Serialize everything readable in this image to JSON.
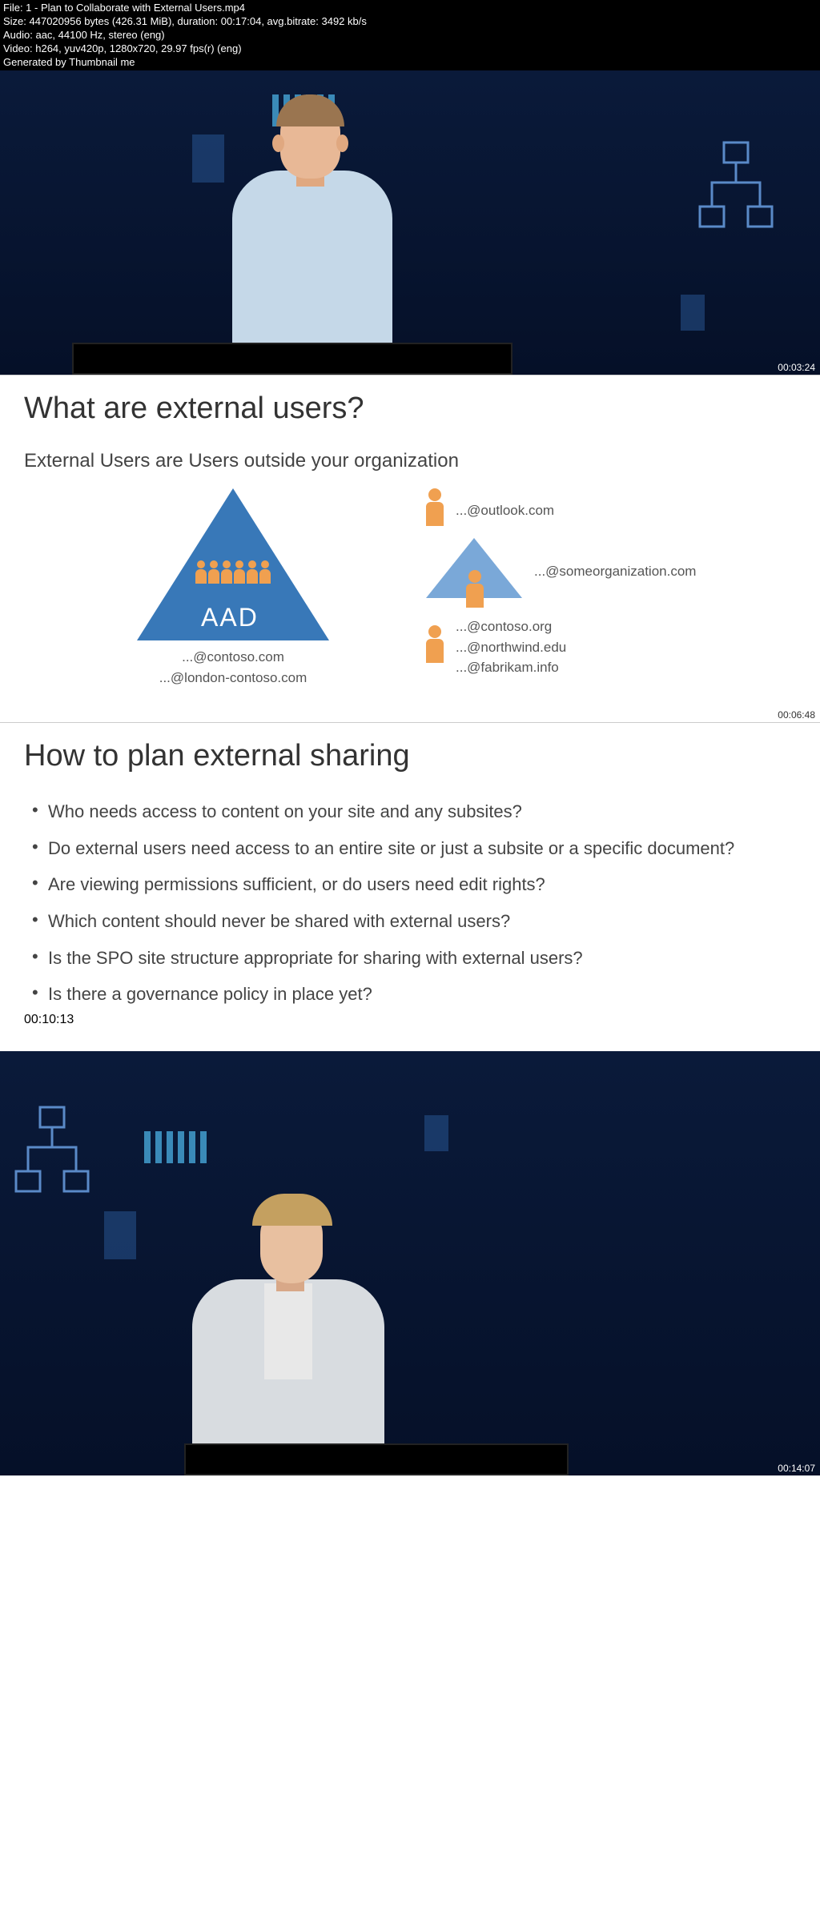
{
  "header": {
    "file": "File: 1 - Plan to Collaborate with External Users.mp4",
    "size": "Size: 447020956 bytes (426.31 MiB), duration: 00:17:04, avg.bitrate: 3492 kb/s",
    "audio": "Audio: aac, 44100 Hz, stereo (eng)",
    "video": "Video: h264, yuv420p, 1280x720, 29.97 fps(r) (eng)",
    "generated": "Generated by Thumbnail me"
  },
  "frame1": {
    "timestamp": "00:03:24"
  },
  "slide1": {
    "title": "What are external users?",
    "subtitle": "External Users are Users outside your organization",
    "aad_label": "AAD",
    "left_domains": [
      "...@contoso.com",
      "...@london-contoso.com"
    ],
    "right1": "...@outlook.com",
    "right2": "...@someorganization.com",
    "right3": [
      "...@contoso.org",
      "...@northwind.edu",
      "...@fabrikam.info"
    ],
    "timestamp": "00:06:48"
  },
  "slide2": {
    "title": "How to plan external sharing",
    "bullets": [
      "Who needs access to content on your site and any subsites?",
      "Do external users need access to an entire site or just a subsite or a specific document?",
      "Are viewing permissions sufficient, or do users need edit rights?",
      "Which content should never be shared with external users?",
      "Is the SPO site structure appropriate for sharing with external users?",
      "Is there a governance policy in place yet?"
    ],
    "timestamp": "00:10:13"
  },
  "frame4": {
    "timestamp": "00:14:07"
  }
}
